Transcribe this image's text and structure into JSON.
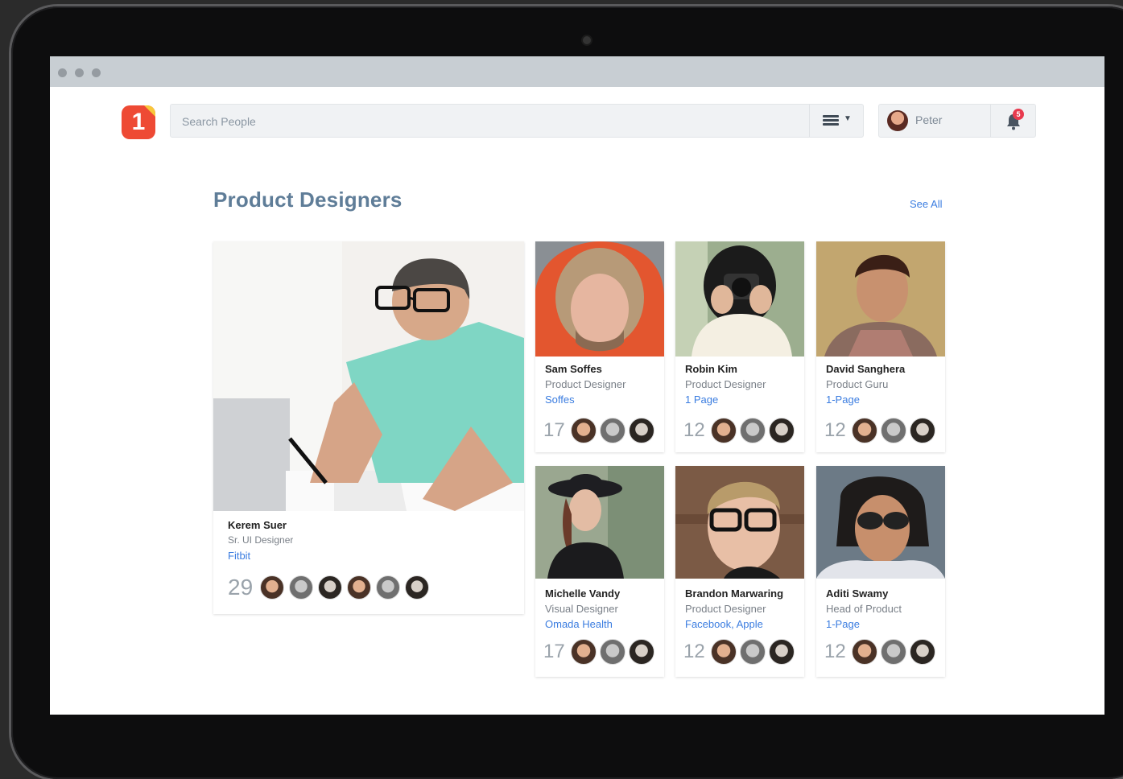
{
  "topbar": {
    "search_placeholder": "Search People",
    "user_name": "Peter",
    "notification_count": "5"
  },
  "section": {
    "title": "Product Designers",
    "see_all": "See All"
  },
  "featured": {
    "name": "Kerem Suer",
    "role": "Sr. UI Designer",
    "company": "Fitbit",
    "count": "29"
  },
  "people": [
    {
      "name": "Sam Soffes",
      "role": "Product Designer",
      "company": "Soffes",
      "count": "17"
    },
    {
      "name": "Robin Kim",
      "role": "Product Designer",
      "company": "1 Page",
      "count": "12"
    },
    {
      "name": "David Sanghera",
      "role": "Product Guru",
      "company": "1-Page",
      "count": "12"
    },
    {
      "name": "Michelle Vandy",
      "role": "Visual Designer",
      "company": "Omada Health",
      "count": "17"
    },
    {
      "name": "Brandon Marwaring",
      "role": "Product Designer",
      "company": "Facebook, Apple",
      "count": "12"
    },
    {
      "name": "Aditi Swamy",
      "role": "Head of Product",
      "company": "1-Page",
      "count": "12"
    }
  ]
}
